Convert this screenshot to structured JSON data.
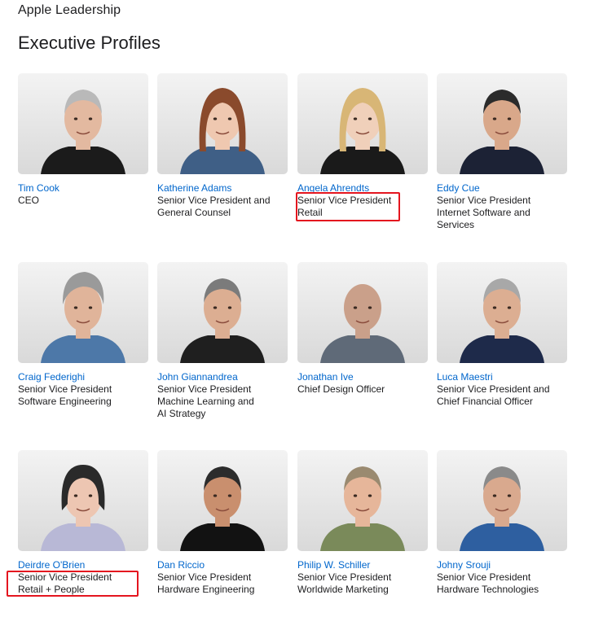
{
  "header": {
    "brand": "Apple Leadership",
    "title": "Executive Profiles"
  },
  "colors": {
    "link": "#0066cc",
    "text": "#1d1d1f",
    "highlight": "#e4151f"
  },
  "profiles": [
    {
      "name": "Tim Cook",
      "title": [
        "CEO"
      ],
      "photo": "portrait-silver-hair-glasses"
    },
    {
      "name": "Katherine Adams",
      "title": [
        "Senior Vice President and",
        "General Counsel"
      ],
      "photo": "portrait-auburn-hair"
    },
    {
      "name": "Angela Ahrendts",
      "title": [
        "Senior Vice President",
        "Retail"
      ],
      "photo": "portrait-blonde-hair",
      "highlighted": true
    },
    {
      "name": "Eddy Cue",
      "title": [
        "Senior Vice President",
        "Internet Software and",
        "Services"
      ],
      "photo": "portrait-dark-hair"
    },
    {
      "name": "Craig Federighi",
      "title": [
        "Senior Vice President",
        "Software Engineering"
      ],
      "photo": "portrait-grey-hair-blue-shirt"
    },
    {
      "name": "John Giannandrea",
      "title": [
        "Senior Vice President",
        "Machine Learning and",
        "AI Strategy"
      ],
      "photo": "portrait-glasses-dark-jacket"
    },
    {
      "name": "Jonathan Ive",
      "title": [
        "Chief Design Officer"
      ],
      "photo": "portrait-shaved-head-grey-tee"
    },
    {
      "name": "Luca Maestri",
      "title": [
        "Senior Vice President and",
        "Chief Financial Officer"
      ],
      "photo": "portrait-grey-hair-navy-shirt"
    },
    {
      "name": "Deirdre O'Brien",
      "title": [
        "Senior Vice President",
        "Retail + People"
      ],
      "photo": "portrait-short-dark-hair",
      "highlighted": true
    },
    {
      "name": "Dan Riccio",
      "title": [
        "Senior Vice President",
        "Hardware Engineering"
      ],
      "photo": "portrait-black-turtleneck"
    },
    {
      "name": "Philip W. Schiller",
      "title": [
        "Senior Vice President",
        "Worldwide Marketing"
      ],
      "photo": "portrait-olive-shirt"
    },
    {
      "name": "Johny Srouji",
      "title": [
        "Senior Vice President",
        "Hardware Technologies"
      ],
      "photo": "portrait-blue-shirt"
    }
  ]
}
